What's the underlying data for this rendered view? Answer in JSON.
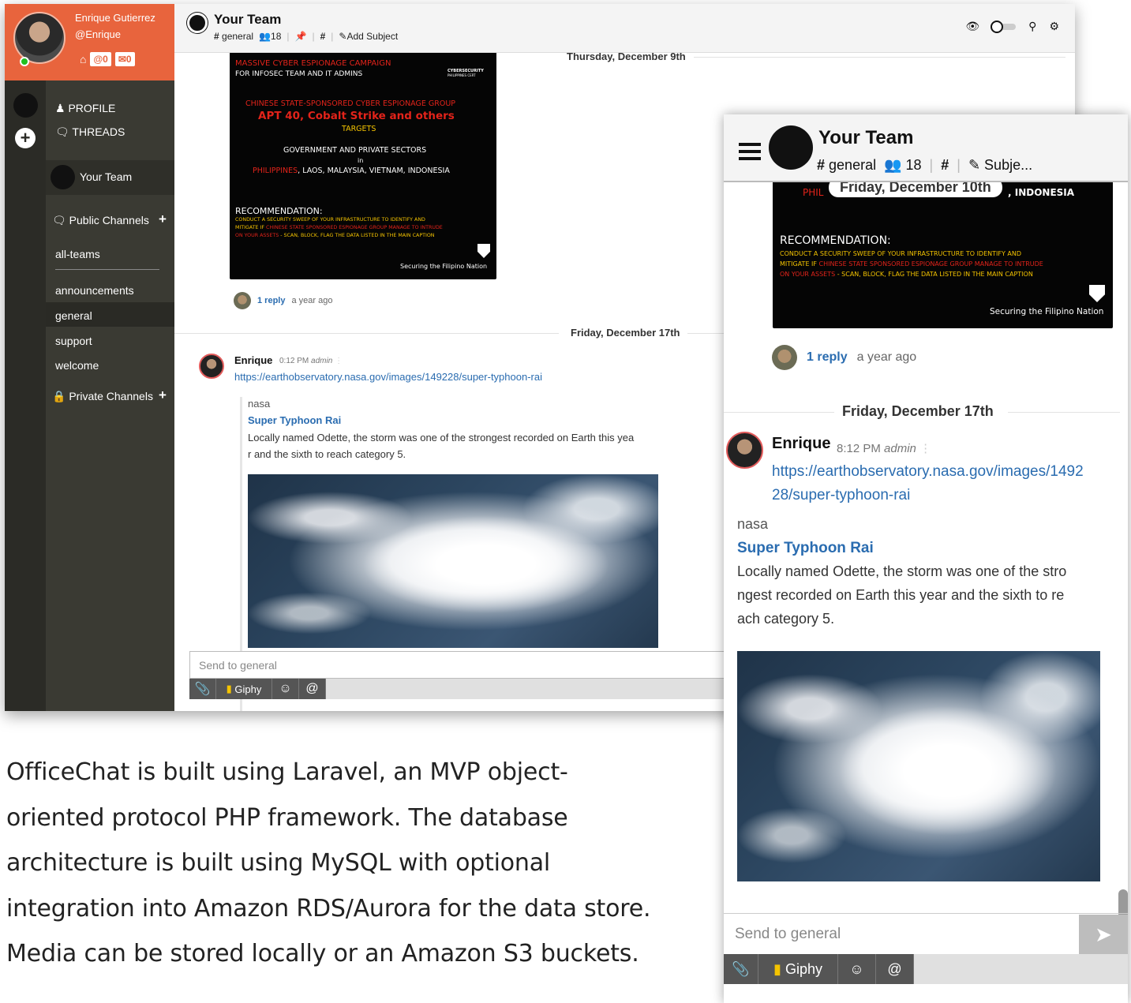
{
  "desktop": {
    "profile": {
      "name": "Enrique Gutierrez",
      "handle": "@Enrique",
      "mentions": "@0",
      "mail": "0"
    },
    "sidebar": {
      "profile_label": "PROFILE",
      "threads_label": "THREADS",
      "team_name": "Your Team",
      "public_header": "Public Channels",
      "channels": [
        "all-teams",
        "announcements",
        "general",
        "support",
        "welcome"
      ],
      "private_header": "Private Channels"
    },
    "topbar": {
      "title": "Your Team",
      "channel": "general",
      "members": "18",
      "add_subject": "Add Subject"
    },
    "messages": {
      "day1": "Thursday, December 9th",
      "poster": {
        "l1": "MASSIVE CYBER ESPIONAGE CAMPAIGN",
        "l2": "FOR INFOSEC TEAM AND IT ADMINS",
        "brand": "CYBERSECURITY",
        "brand2": "PHILIPPINES CERT",
        "l3": "CHINESE STATE-SPONSORED CYBER ESPIONAGE GROUP",
        "l4": "APT 40, Cobalt Strike and others",
        "l5": "TARGETS",
        "l6": "GOVERNMENT AND PRIVATE SECTORS",
        "l7": "in",
        "l8a": "PHILIPPINES",
        "l8b": ", LAOS, MALAYSIA, VIETNAM, INDONESIA",
        "l9": "RECOMMENDATION:",
        "l10": "CONDUCT A SECURITY SWEEP OF YOUR INFRASTRUCTURE TO IDENTIFY AND",
        "l11a": "MITIGATE IF ",
        "l11b": "CHINESE STATE SPONSORED ESPIONAGE GROUP  MANAGE TO INTRUDE",
        "l12a": "ON YOUR ASSETS",
        "l12b": " - SCAN, BLOCK, FLAG THE DATA LISTED  IN THE MAIN CAPTION",
        "footer": "Securing the Filipino Nation"
      },
      "reply_count": "1 reply",
      "reply_time": "a year ago",
      "day2": "Friday, December 17th",
      "author": "Enrique",
      "time": "0:12 PM",
      "role": "admin",
      "link": "https://earthobservatory.nasa.gov/images/149228/super-typhoon-rai",
      "embed_site": "nasa",
      "embed_title": "Super Typhoon Rai",
      "embed_desc_1": "Locally named Odette, the storm was one of the strongest recorded on Earth this yea",
      "embed_desc_2": "r and the sixth to reach category 5."
    },
    "composer": {
      "placeholder": "Send to general",
      "giphy": "Giphy"
    }
  },
  "mobile": {
    "topbar": {
      "title": "Your Team",
      "channel": "general",
      "members": "18",
      "subject": "Subje..."
    },
    "day_sticky": "Friday, December 10th",
    "poster": {
      "top_a": "PHIL",
      "top_b": ", INDONESIA",
      "l9": "RECOMMENDATION:",
      "l10": "CONDUCT A SECURITY SWEEP OF YOUR INFRASTRUCTURE TO IDENTIFY AND",
      "l11a": "MITIGATE IF ",
      "l11b": "CHINESE STATE SPONSORED ESPIONAGE GROUP  MANAGE TO INTRUDE",
      "l12a": "ON YOUR ASSETS",
      "l12b": " - SCAN, BLOCK, FLAG THE DATA LISTED  IN THE MAIN CAPTION",
      "footer": "Securing the Filipino Nation"
    },
    "reply_count": "1 reply",
    "reply_time": "a year ago",
    "day2": "Friday, December 17th",
    "author": "Enrique",
    "time": "8:12 PM",
    "role": "admin",
    "link_1": "https://earthobservatory.nasa.gov/images/1492",
    "link_2": "28/super-typhoon-rai",
    "embed_site": "nasa",
    "embed_title": "Super Typhoon Rai",
    "embed_desc_1": "Locally named Odette, the storm was one of the stro",
    "embed_desc_2": "ngest recorded on Earth this year and the sixth to re",
    "embed_desc_3": "ach category 5.",
    "composer": {
      "placeholder": "Send to general",
      "giphy": "Giphy"
    }
  },
  "caption": {
    "line1": "OfficeChat is built using Laravel, an MVP object-",
    "line2": "oriented protocol PHP framework. The database",
    "line3": "architecture is built using MySQL with optional",
    "line4": "integration into Amazon RDS/Aurora for the data store.",
    "line5": "Media can be stored locally or an Amazon S3 buckets."
  },
  "colors": {
    "accent": "#e8643d",
    "link": "#2a6cb0",
    "sidebar": "#3a3a33",
    "rail": "#2b2b26"
  }
}
